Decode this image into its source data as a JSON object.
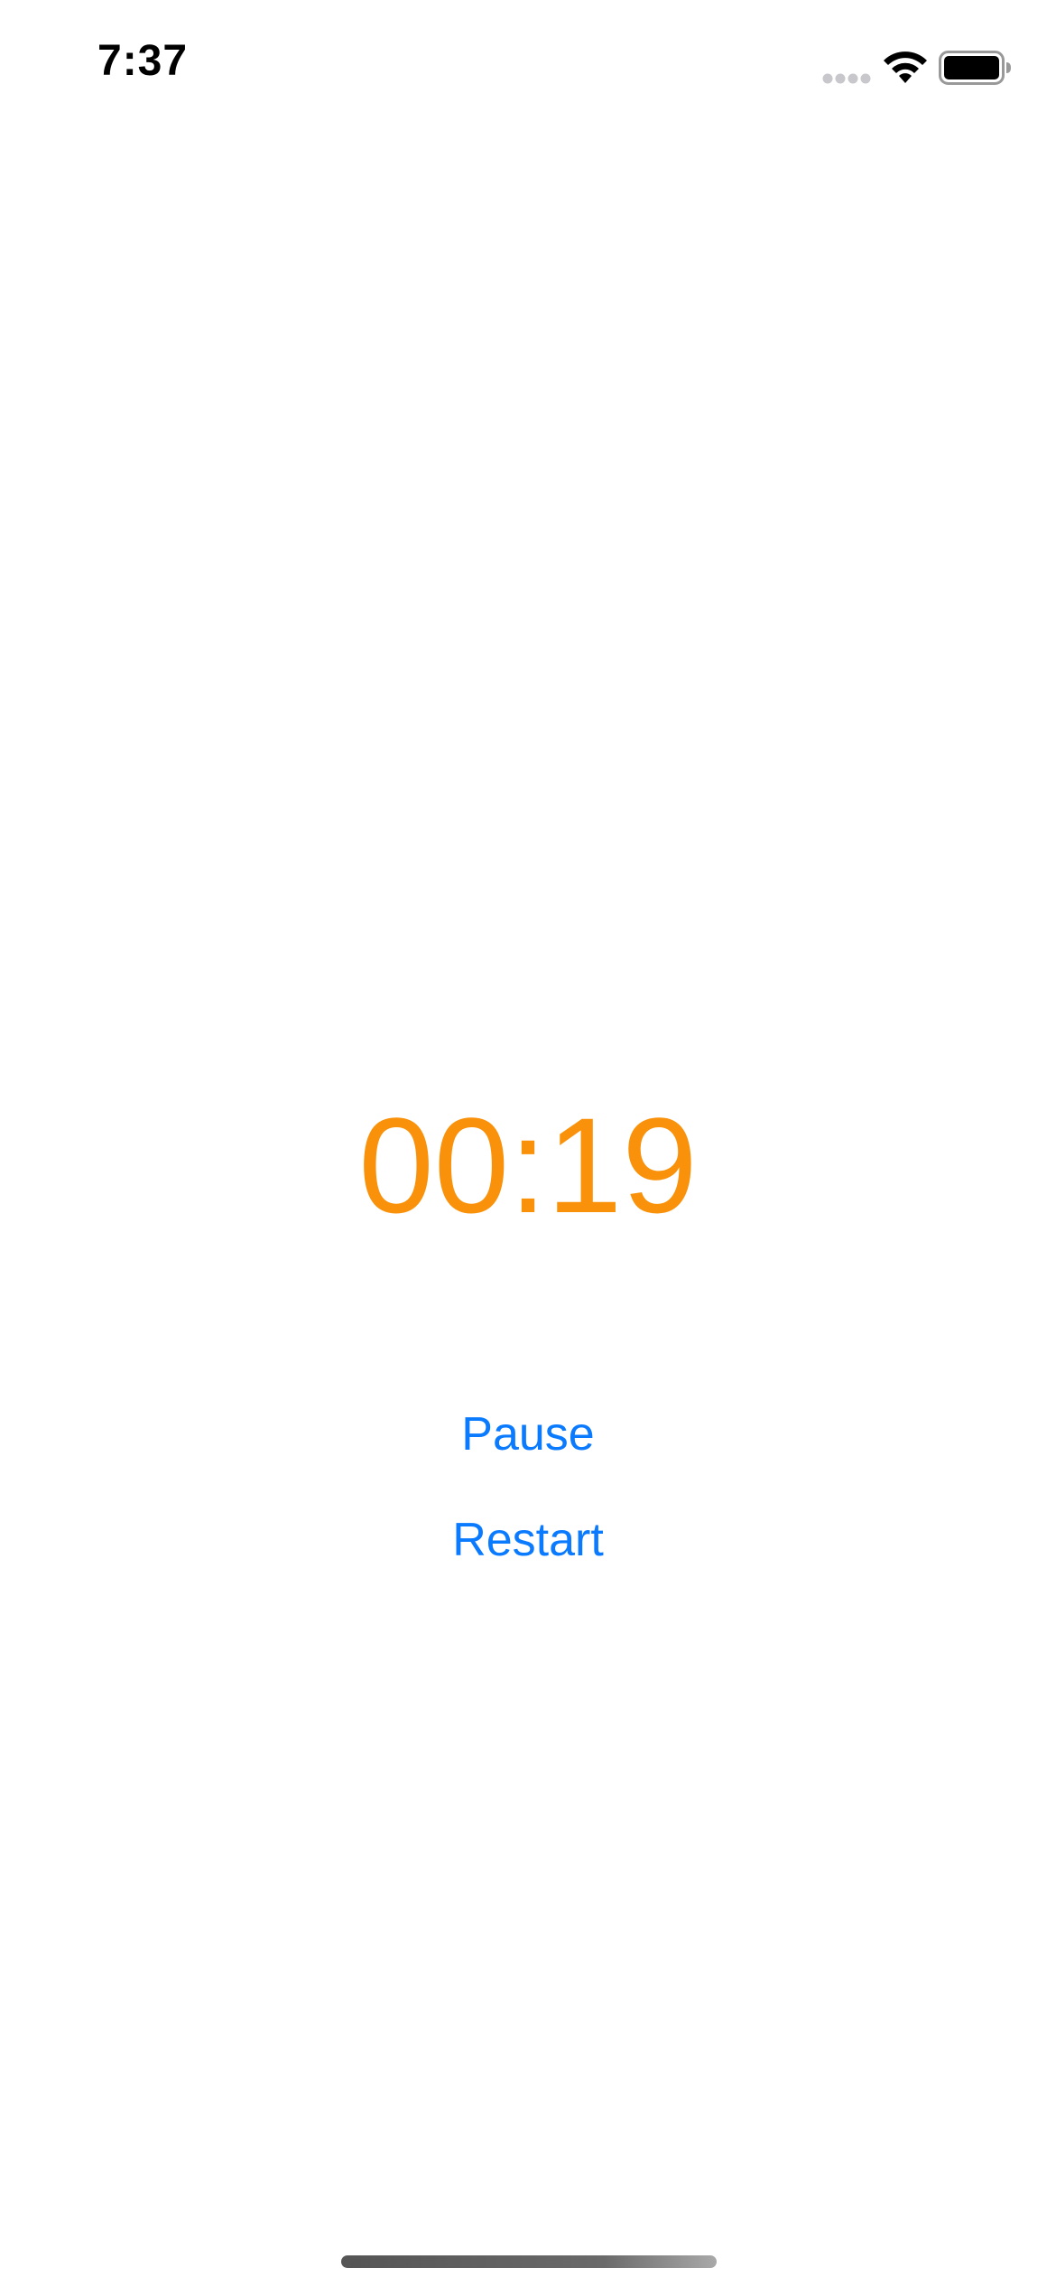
{
  "status_bar": {
    "time": "7:37",
    "icons": [
      "signal-dots-icon",
      "wifi-icon",
      "battery-icon"
    ]
  },
  "timer": {
    "display": "00:19",
    "color": "#F9920A"
  },
  "controls": {
    "pause_label": "Pause",
    "restart_label": "Restart",
    "accent_color": "#0A7AFF"
  }
}
